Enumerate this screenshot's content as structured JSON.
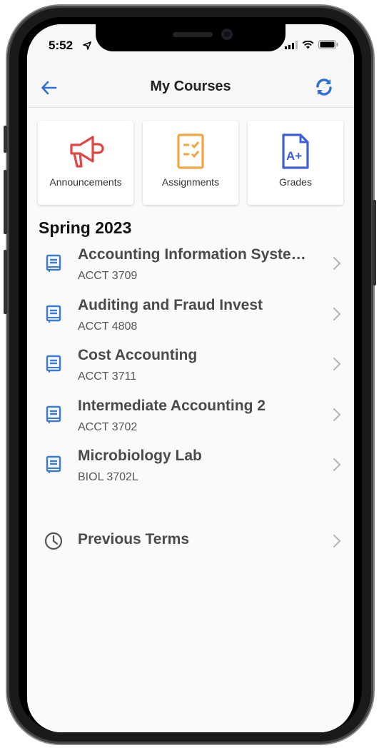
{
  "status_bar": {
    "time": "5:52"
  },
  "nav": {
    "title": "My Courses"
  },
  "tiles": [
    {
      "label": "Announcements",
      "icon": "megaphone-icon",
      "color": "#e04646"
    },
    {
      "label": "Assignments",
      "icon": "checklist-icon",
      "color": "#f2a541"
    },
    {
      "label": "Grades",
      "icon": "grade-doc-icon",
      "color": "#3d5fd9"
    }
  ],
  "term": {
    "title": "Spring 2023"
  },
  "courses": [
    {
      "name": "Accounting Information Syste…",
      "code": "ACCT 3709"
    },
    {
      "name": "Auditing and Fraud Invest",
      "code": "ACCT 4808"
    },
    {
      "name": "Cost Accounting",
      "code": "ACCT 3711"
    },
    {
      "name": "Intermediate Accounting 2",
      "code": "ACCT 3702"
    },
    {
      "name": "Microbiology Lab",
      "code": "BIOL 3702L"
    }
  ],
  "previous_terms": {
    "label": "Previous Terms"
  },
  "colors": {
    "accent": "#2f6fd6",
    "book_icon": "#3b7bd8"
  }
}
